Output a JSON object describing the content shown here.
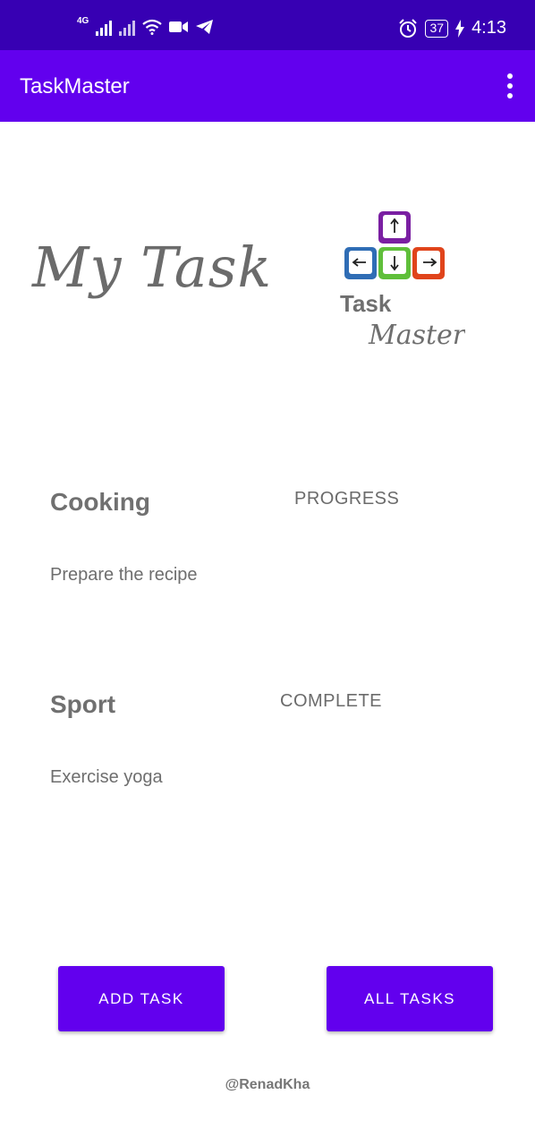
{
  "status_bar": {
    "network_label": "4G",
    "time": "4:13",
    "battery": "37",
    "icons": [
      "signal-icon",
      "wifi-icon",
      "video-icon",
      "telegram-icon",
      "alarm-icon",
      "battery-icon",
      "charging-icon"
    ]
  },
  "app_bar": {
    "title": "TaskMaster",
    "menu_icon": "more-vert-icon"
  },
  "header": {
    "heading": "My Task",
    "logo": {
      "line1": "Task",
      "line2": "Master",
      "keys": [
        "up-arrow-icon",
        "left-arrow-icon",
        "down-arrow-icon",
        "right-arrow-icon"
      ],
      "key_colors": [
        "#7a1fa2",
        "#2f6db5",
        "#5fbf3a",
        "#e0441b"
      ]
    }
  },
  "tasks": [
    {
      "title": "Cooking",
      "status": "PROGRESS",
      "body": "Prepare the recipe"
    },
    {
      "title": "Sport",
      "status": "COMPLETE",
      "body": "Exercise yoga"
    }
  ],
  "buttons": {
    "add_task": "ADD TASK",
    "all_tasks": "ALL TASKS"
  },
  "footer": {
    "username": "@RenadKha"
  },
  "colors": {
    "status_bar": "#3700B3",
    "app_bar": "#6200EE",
    "button": "#6200EE"
  }
}
